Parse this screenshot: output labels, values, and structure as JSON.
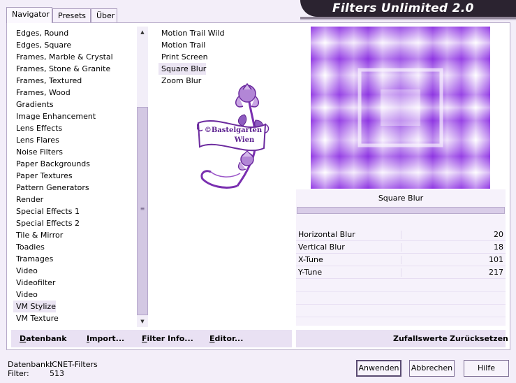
{
  "title": "Filters Unlimited 2.0",
  "tabs": [
    {
      "label": "Navigator",
      "active": true
    },
    {
      "label": "Presets",
      "active": false
    },
    {
      "label": "Über",
      "active": false
    }
  ],
  "categories": [
    "Edges, Round",
    "Edges, Square",
    "Frames, Marble & Crystal",
    "Frames, Stone & Granite",
    "Frames, Textured",
    "Frames, Wood",
    "Gradients",
    "Image Enhancement",
    "Lens Effects",
    "Lens Flares",
    "Noise Filters",
    "Paper Backgrounds",
    "Paper Textures",
    "Pattern Generators",
    "Render",
    "Special Effects 1",
    "Special Effects 2",
    "Tile & Mirror",
    "Toadies",
    "Tramages",
    "Video",
    "Videofilter",
    "Video",
    "VM Stylize",
    "VM Texture"
  ],
  "selected_category": "VM Stylize",
  "filters": [
    "Motion Trail Wild",
    "Motion Trail",
    "Print Screen",
    "Square Blur",
    "Zoom Blur"
  ],
  "selected_filter": "Square Blur",
  "watermark": {
    "line1": "©Bastelgarten",
    "line2": "Wien"
  },
  "filter_title": "Square Blur",
  "params": [
    {
      "label": "Horizontal Blur",
      "value": "20"
    },
    {
      "label": "Vertical Blur",
      "value": "18"
    },
    {
      "label": "X-Tune",
      "value": "101"
    },
    {
      "label": "Y-Tune",
      "value": "217"
    }
  ],
  "toolbar_left": [
    {
      "u": "D",
      "rest": "atenbank"
    },
    {
      "u": "I",
      "rest": "mport..."
    },
    {
      "u": "F",
      "rest": "ilter Info..."
    },
    {
      "u": "E",
      "rest": "ditor..."
    }
  ],
  "toolbar_right": [
    "Zufallswerte",
    "Zurücksetzen"
  ],
  "info": {
    "db_label": "Datenbank:",
    "db_value": "ICNET-Filters",
    "filter_label": "Filter:",
    "filter_value": "513"
  },
  "buttons": {
    "apply": "Anwenden",
    "cancel": "Abbrechen",
    "help": "Hilfe"
  },
  "icons": {
    "scroll_up": "triangle-up",
    "scroll_down": "triangle-down"
  },
  "colors": {
    "accent": "#8a2be2",
    "banner": "#2b2330",
    "background": "#f3eef9",
    "selection": "#ebe5f3"
  }
}
